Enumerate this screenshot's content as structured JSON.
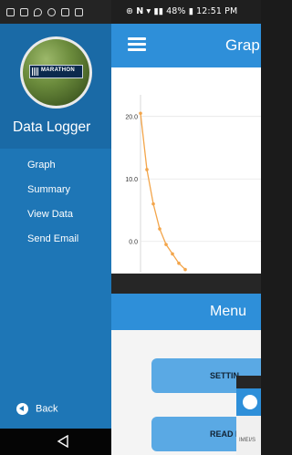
{
  "back_screen": {
    "status_time": "12:51 PM",
    "battery": "48%",
    "title": "Grap",
    "chart_data": {
      "type": "line",
      "y_ticks": [
        "20.0",
        "10.0",
        "0.0"
      ],
      "ylim": [
        -5,
        22
      ],
      "x": [
        0,
        1,
        2,
        3,
        4,
        5,
        6,
        7
      ],
      "values": [
        20.5,
        11.5,
        6.0,
        2.0,
        -0.5,
        -2.0,
        -3.5,
        -4.5
      ],
      "colors": {
        "line": "#f3a54a",
        "grid": "#e6e6e6"
      }
    }
  },
  "drawer": {
    "logo_text": "MARATHON",
    "app_name": "Data Logger",
    "items": [
      {
        "label": "Graph"
      },
      {
        "label": "Summary"
      },
      {
        "label": "View Data"
      },
      {
        "label": "Send Email"
      }
    ],
    "back_label": "Back"
  },
  "front_screen": {
    "title": "Menu",
    "buttons": [
      {
        "label": "SETTIN"
      },
      {
        "label": "READ D"
      }
    ]
  },
  "third_screen": {
    "label": "IMEI/S"
  },
  "colors": {
    "drawer": "#1e76b6",
    "appbar": "#2e8fd9",
    "button": "#5aa9e4"
  }
}
